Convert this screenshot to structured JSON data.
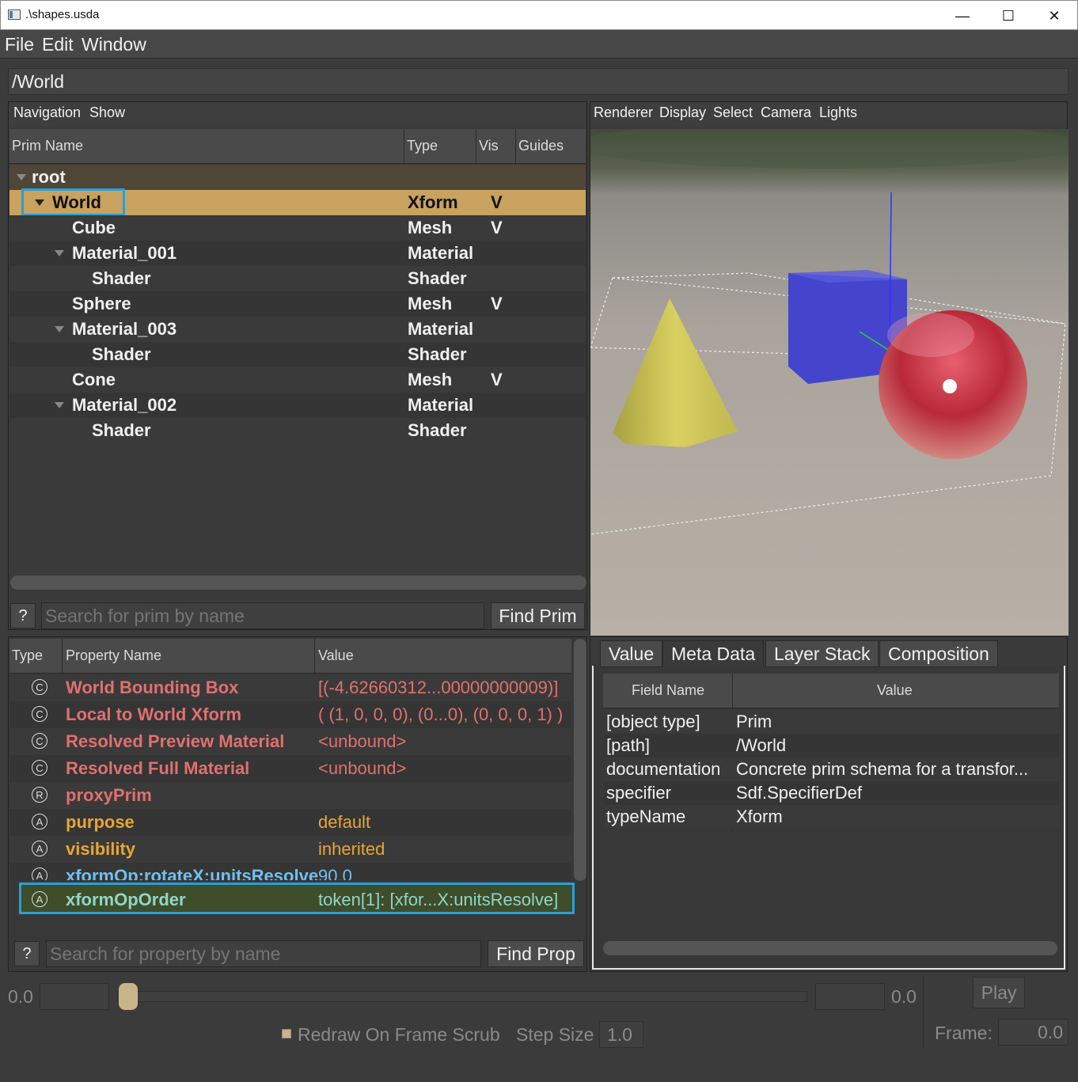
{
  "window": {
    "title": ".\\shapes.usda",
    "minimize": "—",
    "maximize": "☐",
    "close": "✕"
  },
  "menu": [
    "File",
    "Edit",
    "Window"
  ],
  "path": "/World",
  "prim_browser": {
    "toolbar": [
      "Navigation",
      "Show"
    ],
    "columns": [
      "Prim Name",
      "Type",
      "Vis",
      "Guides"
    ],
    "rows": [
      {
        "name": "root",
        "type": "",
        "vis": ""
      },
      {
        "name": "World",
        "type": "Xform",
        "vis": "V"
      },
      {
        "name": "Cube",
        "type": "Mesh",
        "vis": "V"
      },
      {
        "name": "Material_001",
        "type": "Material",
        "vis": ""
      },
      {
        "name": "Shader",
        "type": "Shader",
        "vis": ""
      },
      {
        "name": "Sphere",
        "type": "Mesh",
        "vis": "V"
      },
      {
        "name": "Material_003",
        "type": "Material",
        "vis": ""
      },
      {
        "name": "Shader",
        "type": "Shader",
        "vis": ""
      },
      {
        "name": "Cone",
        "type": "Mesh",
        "vis": "V"
      },
      {
        "name": "Material_002",
        "type": "Material",
        "vis": ""
      },
      {
        "name": "Shader",
        "type": "Shader",
        "vis": ""
      }
    ],
    "help_label": "?",
    "search_placeholder": "Search for prim by name",
    "find_label": "Find Prim"
  },
  "viewport": {
    "toolbar": [
      "Renderer",
      "Display",
      "Select",
      "Camera",
      "Lights"
    ]
  },
  "properties": {
    "columns": [
      "Type",
      "Property Name",
      "Value"
    ],
    "rows": [
      {
        "icon": "C",
        "name": "World Bounding Box",
        "value": "[(-4.62660312...00000000009)]"
      },
      {
        "icon": "C",
        "name": "Local to World Xform",
        "value": "( (1, 0, 0, 0), (0...0), (0, 0, 0, 1) )"
      },
      {
        "icon": "C",
        "name": "Resolved Preview Material",
        "value": "<unbound>"
      },
      {
        "icon": "C",
        "name": "Resolved Full Material",
        "value": "<unbound>"
      },
      {
        "icon": "R",
        "name": "proxyPrim",
        "value": ""
      },
      {
        "icon": "A",
        "name": "purpose",
        "value": "default"
      },
      {
        "icon": "A",
        "name": "visibility",
        "value": "inherited"
      },
      {
        "icon": "A",
        "name": "xformOp:rotateX:unitsResolve",
        "value": "90.0"
      },
      {
        "icon": "A",
        "name": "xformOpOrder",
        "value": "token[1]: [xfor...X:unitsResolve]"
      }
    ],
    "help_label": "?",
    "search_placeholder": "Search for property by name",
    "find_label": "Find Prop"
  },
  "metadata": {
    "tabs": [
      "Value",
      "Meta Data",
      "Layer Stack",
      "Composition"
    ],
    "columns": [
      "Field Name",
      "Value"
    ],
    "rows": [
      {
        "field": "[object type]",
        "value": "Prim"
      },
      {
        "field": "[path]",
        "value": "/World"
      },
      {
        "field": "documentation",
        "value": "Concrete prim schema for a transfor..."
      },
      {
        "field": "specifier",
        "value": "Sdf.SpecifierDef"
      },
      {
        "field": "typeName",
        "value": "Xform"
      }
    ]
  },
  "timeline": {
    "start": "0.0",
    "end": "0.0",
    "play": "Play",
    "redraw_label": "Redraw On Frame Scrub",
    "step_label": "Step Size",
    "step_value": "1.0",
    "frame_label": "Frame:",
    "frame_value": "0.0"
  },
  "colors": {
    "selection": "#c8a25e",
    "highlight_border": "#2a9fd8",
    "selected_prop_row": "#3e4d2a"
  }
}
